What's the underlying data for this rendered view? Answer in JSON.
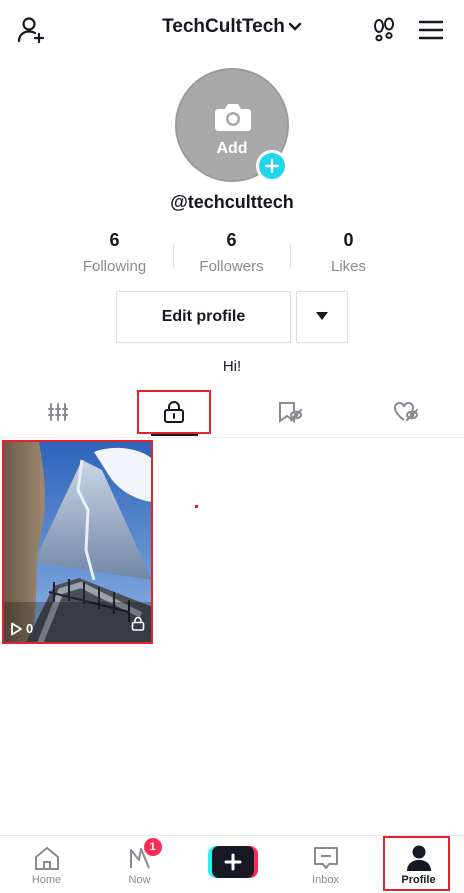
{
  "header": {
    "account_name": "TechCultTech",
    "icons": [
      "add-friend-icon",
      "chevron-down-icon",
      "footprints-icon",
      "hamburger-menu-icon"
    ]
  },
  "profile": {
    "avatar_add_label": "Add",
    "username": "@techculttech",
    "bio": "Hi!"
  },
  "stats": [
    {
      "value": "6",
      "label": "Following"
    },
    {
      "value": "6",
      "label": "Followers"
    },
    {
      "value": "0",
      "label": "Likes"
    }
  ],
  "actions": {
    "edit_profile_label": "Edit profile"
  },
  "tabs": [
    {
      "icon": "videos-grid-icon",
      "selected": false
    },
    {
      "icon": "lock-icon",
      "selected": true
    },
    {
      "icon": "hidden-bookmark-icon",
      "selected": false
    },
    {
      "icon": "hidden-liked-icon",
      "selected": false
    }
  ],
  "videos": [
    {
      "play_count": "0",
      "private": true
    }
  ],
  "bottom_nav": {
    "home": "Home",
    "now": "Now",
    "now_badge": "1",
    "inbox": "Inbox",
    "profile": "Profile"
  },
  "colors": {
    "accent_cyan": "#20d5ec",
    "badge_red": "#fe2c55",
    "highlight_red": "#e0242e",
    "text_primary": "#161823",
    "text_secondary": "#8a8b91"
  }
}
